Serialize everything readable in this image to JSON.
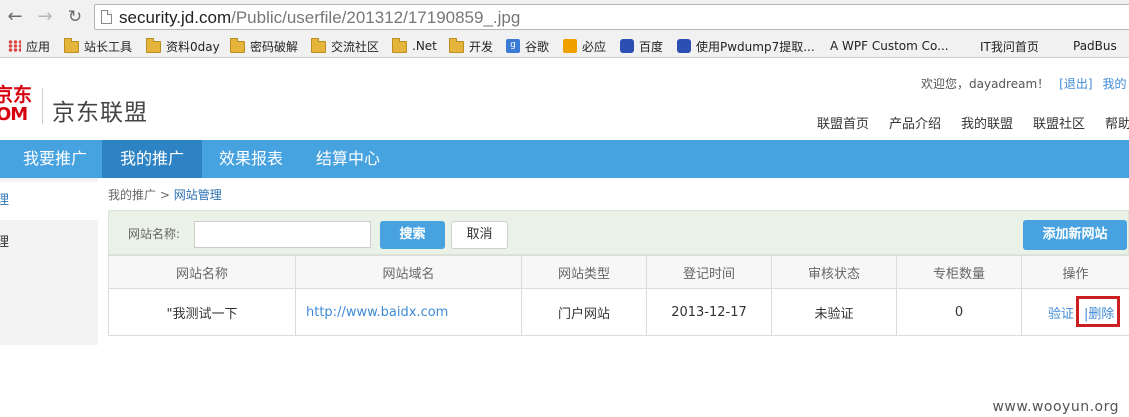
{
  "browser": {
    "url_host": "security.jd.com",
    "url_path": "/Public/userfile/201312/17190859_.jpg",
    "bookmarks": [
      "应用",
      "站长工具",
      "资料0day",
      "密码破解",
      "交流社区",
      ".Net",
      "开发",
      "谷歌",
      "必应",
      "百度",
      "使用Pwdump7提取...",
      "A WPF Custom Co...",
      "IT我问首页",
      "PadBus"
    ]
  },
  "header": {
    "logo_line1": "京东",
    "logo_line2": "OM",
    "brand": "京东联盟",
    "welcome": "欢迎您，dayadream！",
    "logout": "[退出]",
    "my": "我的",
    "topnav": [
      "联盟首页",
      "产品介绍",
      "我的联盟",
      "联盟社区",
      "帮助"
    ]
  },
  "main_nav": [
    "我要推广",
    "我的推广",
    "效果报表",
    "结算中心"
  ],
  "sidebar": [
    "理",
    "理"
  ],
  "breadcrumb": {
    "parent": "我的推广",
    "sep": ">",
    "current": "网站管理"
  },
  "search": {
    "label": "网站名称:",
    "value": "",
    "search_btn": "搜索",
    "cancel_btn": "取消",
    "add_btn": "添加新网站"
  },
  "table": {
    "headers": [
      "网站名称",
      "网站域名",
      "网站类型",
      "登记时间",
      "审核状态",
      "专柜数量",
      "操作"
    ],
    "rows": [
      {
        "name": "\"我测试一下",
        "domain": "http://www.baidx.com",
        "type": "门户网站",
        "date": "2013-12-17",
        "status": "未验证",
        "count": "0",
        "verify": "验证",
        "sep": "|",
        "delete": "删除"
      }
    ]
  },
  "watermark": "www.wooyun.org",
  "colors": {
    "accent": "#47a2e0",
    "active_tab": "#2d83c3",
    "highlight": "#cc1f1f",
    "jd_red": "#d7000f"
  }
}
